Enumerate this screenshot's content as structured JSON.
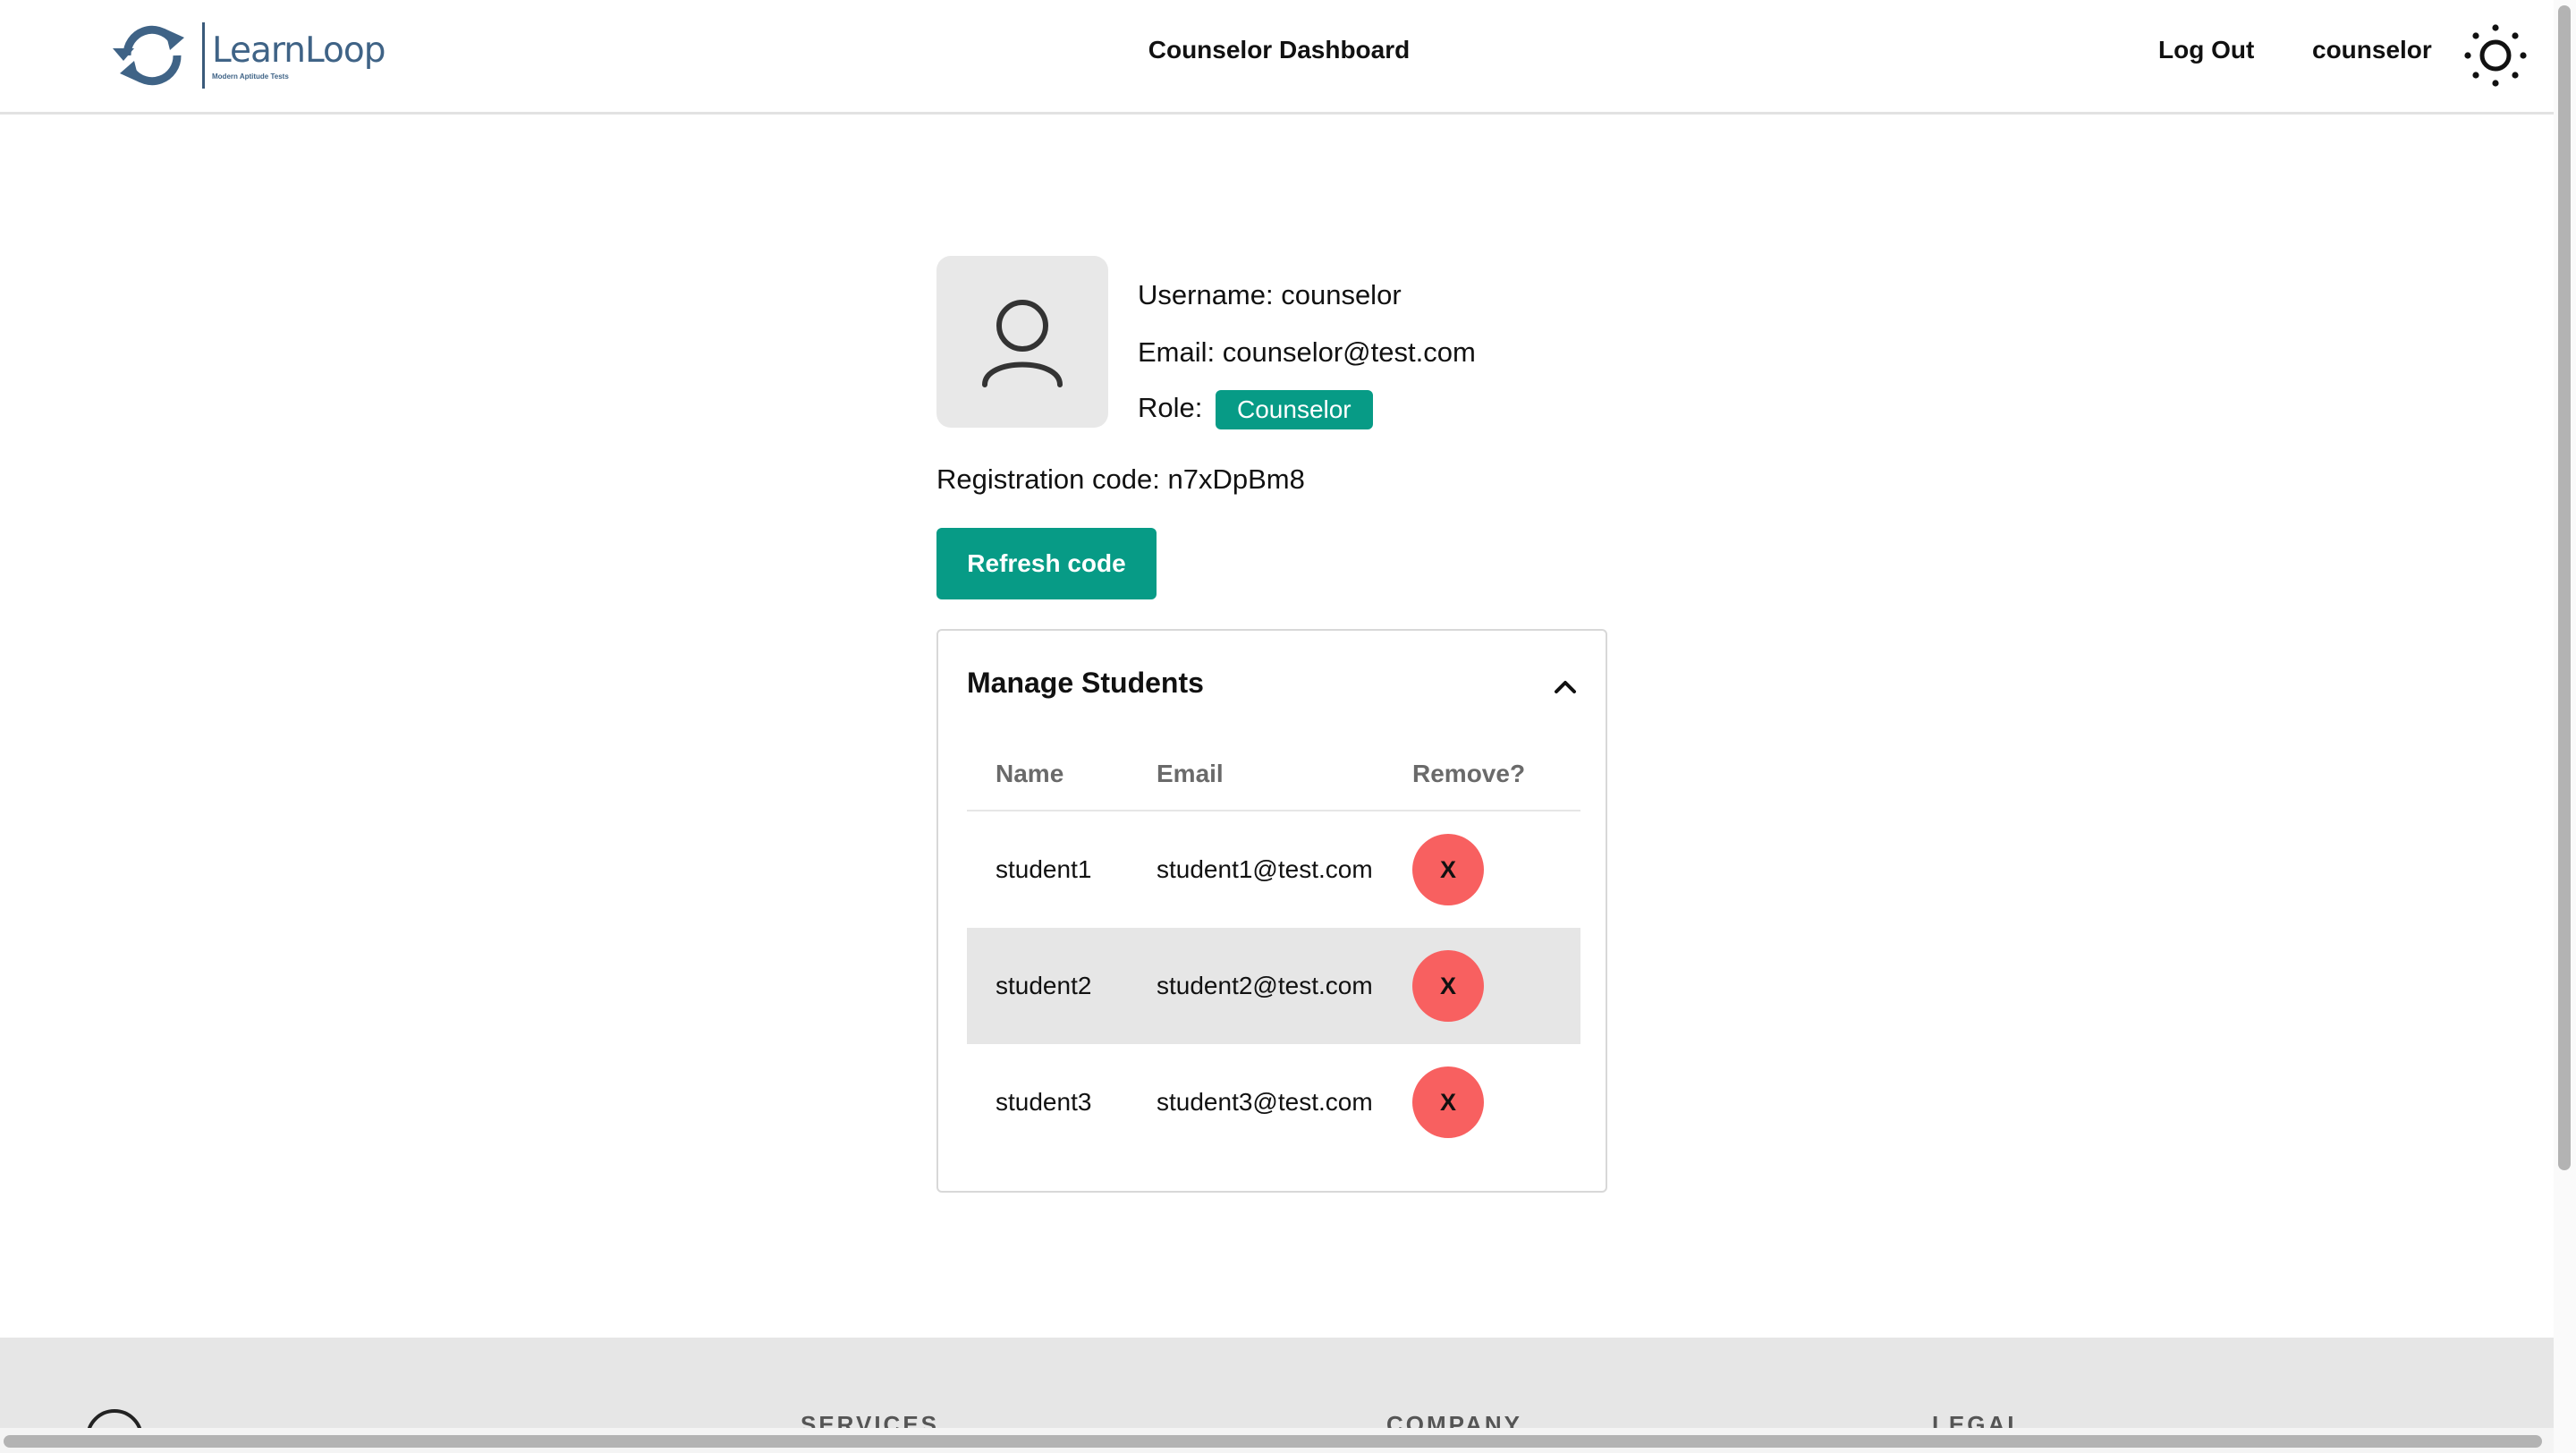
{
  "header": {
    "logo": {
      "name": "LearnLoop",
      "tagline": "Modern Aptitude Tests"
    },
    "title": "Counselor Dashboard",
    "logout_label": "Log Out",
    "username": "counselor",
    "theme_icon": "sun-icon"
  },
  "profile": {
    "username_text": "Username: counselor",
    "email_text": "Email: counselor@test.com",
    "role_label": "Role:",
    "role_badge": "Counselor",
    "registration_text": "Registration code: n7xDpBm8",
    "refresh_label": "Refresh code"
  },
  "students_panel": {
    "title": "Manage Students",
    "expanded": true,
    "columns": [
      "Name",
      "Email",
      "Remove?"
    ],
    "rows": [
      {
        "name": "student1",
        "email": "student1@test.com",
        "remove_label": "X"
      },
      {
        "name": "student2",
        "email": "student2@test.com",
        "remove_label": "X"
      },
      {
        "name": "student3",
        "email": "student3@test.com",
        "remove_label": "X"
      }
    ]
  },
  "footer": {
    "headings": [
      "SERVICES",
      "COMPANY",
      "LEGAL"
    ]
  },
  "colors": {
    "accent": "#079b86",
    "remove": "#f86060",
    "logo_blue": "#3f6386",
    "footer_bg": "#e6e6e6"
  }
}
